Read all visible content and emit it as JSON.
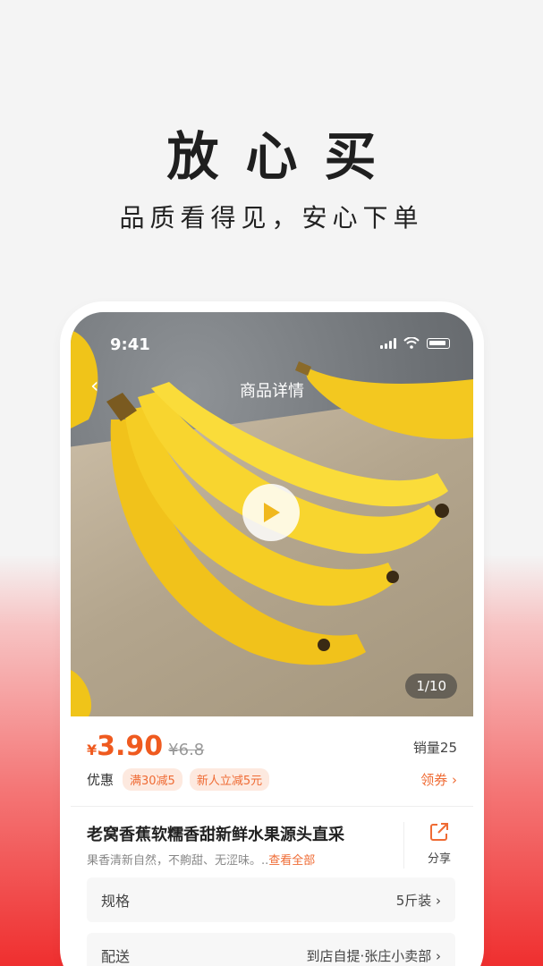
{
  "hero": {
    "title": "放心买",
    "subtitle": "品质看得见，安心下单"
  },
  "status_bar": {
    "time": "9:41"
  },
  "nav": {
    "back": "‹",
    "title": "商品详情"
  },
  "media": {
    "counter": "1/10"
  },
  "product": {
    "currency": "¥",
    "price": "3.90",
    "old_price": "¥6.8",
    "sales": "销量25",
    "promo_label": "优惠",
    "promo_tags": [
      "满30减5",
      "新人立减5元"
    ],
    "coupon": "领券 ›",
    "name": "老窝香蕉软糯香甜新鲜水果源头直采",
    "description": "果香清新自然，不齁甜、无涩味。..",
    "description_more": "查看全部",
    "share_label": "分享"
  },
  "spec": {
    "label": "规格",
    "value": "5斤装 ›"
  },
  "delivery": {
    "label": "配送",
    "value": "到店自提·张庄小卖部 ›"
  },
  "colors": {
    "accent": "#ef5a1f",
    "tag_bg": "#fde9df"
  }
}
